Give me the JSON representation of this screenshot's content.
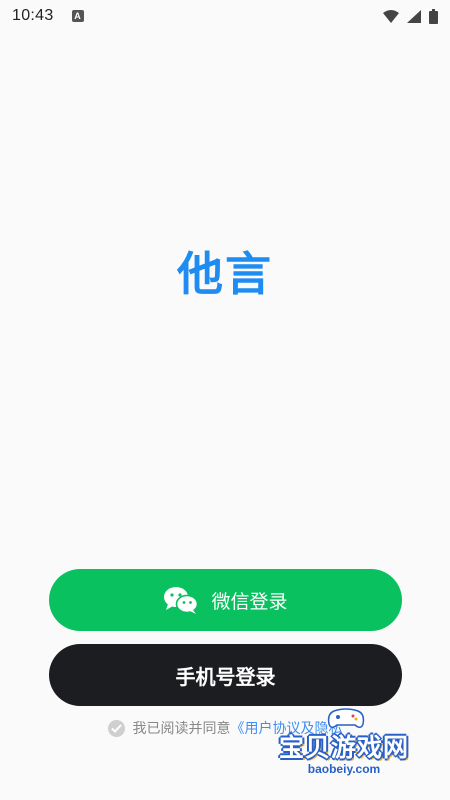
{
  "status_bar": {
    "time": "10:43",
    "notification_icon_letter": "A",
    "icons": [
      "wifi-icon",
      "signal-icon",
      "battery-icon"
    ]
  },
  "app": {
    "logo_text": "他言",
    "logo_color": "#1e8cf0"
  },
  "buttons": {
    "wechat_login": "微信登录",
    "phone_login": "手机号登录"
  },
  "agreement": {
    "prefix": "我已阅读并同意",
    "link": "《用户协议及隐私"
  },
  "watermark": {
    "title": "宝贝游戏网",
    "url": "baobeiy.com"
  },
  "colors": {
    "wechat_green": "#0ac160",
    "phone_button": "#1c1d21",
    "link_blue": "#3f8ef0",
    "background": "#fafafa"
  }
}
